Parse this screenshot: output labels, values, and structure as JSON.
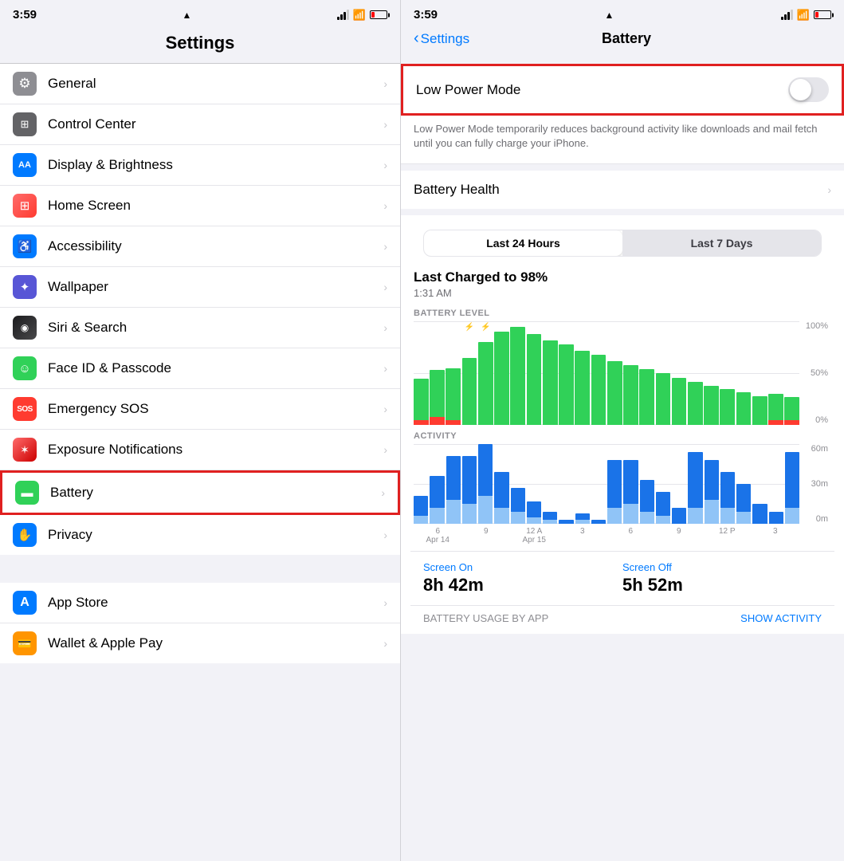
{
  "left": {
    "status": {
      "time": "3:59",
      "location_arrow": "▲"
    },
    "title": "Settings",
    "items": [
      {
        "id": "general",
        "label": "General",
        "icon": "⚙️",
        "iconClass": "ic-general",
        "iconText": "⚙"
      },
      {
        "id": "control-center",
        "label": "Control Center",
        "icon": "",
        "iconClass": "ic-control",
        "iconText": "⊞"
      },
      {
        "id": "display",
        "label": "Display & Brightness",
        "icon": "",
        "iconClass": "ic-display",
        "iconText": "AA"
      },
      {
        "id": "home-screen",
        "label": "Home Screen",
        "icon": "",
        "iconClass": "ic-home",
        "iconText": "⊞"
      },
      {
        "id": "accessibility",
        "label": "Accessibility",
        "icon": "",
        "iconClass": "ic-accessibility",
        "iconText": "♿"
      },
      {
        "id": "wallpaper",
        "label": "Wallpaper",
        "icon": "",
        "iconClass": "ic-wallpaper",
        "iconText": "✦"
      },
      {
        "id": "siri",
        "label": "Siri & Search",
        "icon": "",
        "iconClass": "ic-siri",
        "iconText": "◉"
      },
      {
        "id": "faceid",
        "label": "Face ID & Passcode",
        "icon": "",
        "iconClass": "ic-faceid",
        "iconText": "☺"
      },
      {
        "id": "sos",
        "label": "Emergency SOS",
        "icon": "",
        "iconClass": "ic-sos",
        "iconText": "SOS"
      },
      {
        "id": "exposure",
        "label": "Exposure Notifications",
        "icon": "",
        "iconClass": "ic-exposure",
        "iconText": "✶"
      },
      {
        "id": "battery",
        "label": "Battery",
        "icon": "",
        "iconClass": "ic-battery",
        "iconText": "▬",
        "highlighted": true
      },
      {
        "id": "privacy",
        "label": "Privacy",
        "icon": "",
        "iconClass": "ic-privacy",
        "iconText": "✋"
      }
    ],
    "section2": [
      {
        "id": "appstore",
        "label": "App Store",
        "icon": "",
        "iconClass": "ic-appstore",
        "iconText": "A"
      },
      {
        "id": "wallet",
        "label": "Wallet & Apple Pay",
        "icon": "",
        "iconClass": "ic-wallet",
        "iconText": "💳"
      }
    ]
  },
  "right": {
    "status": {
      "time": "3:59"
    },
    "nav": {
      "back_label": "Settings",
      "title": "Battery"
    },
    "low_power_mode": {
      "label": "Low Power Mode",
      "description": "Low Power Mode temporarily reduces background activity like downloads and mail fetch until you can fully charge your iPhone.",
      "enabled": false
    },
    "battery_health": {
      "label": "Battery Health"
    },
    "time_segments": {
      "option1": "Last 24 Hours",
      "option2": "Last 7 Days",
      "active": 0
    },
    "charge_info": {
      "title": "Last Charged to 98%",
      "time": "1:31 AM"
    },
    "battery_chart": {
      "label": "BATTERY LEVEL",
      "y_labels": [
        "100%",
        "50%",
        "0%"
      ]
    },
    "activity_chart": {
      "label": "ACTIVITY",
      "y_labels": [
        "60m",
        "30m",
        "0m"
      ]
    },
    "x_axis": [
      {
        "time": "6",
        "date": "Apr 14"
      },
      {
        "time": "9",
        "date": ""
      },
      {
        "time": "12 A",
        "date": "Apr 15"
      },
      {
        "time": "3",
        "date": ""
      },
      {
        "time": "6",
        "date": ""
      },
      {
        "time": "9",
        "date": ""
      },
      {
        "time": "12 P",
        "date": ""
      },
      {
        "time": "3",
        "date": ""
      }
    ],
    "screen_on": {
      "label": "Screen On",
      "value": "8h 42m"
    },
    "screen_off": {
      "label": "Screen Off",
      "value": "5h 52m"
    },
    "bottom": {
      "usage_label": "BATTERY USAGE BY APP",
      "show_activity": "SHOW ACTIVITY"
    }
  }
}
